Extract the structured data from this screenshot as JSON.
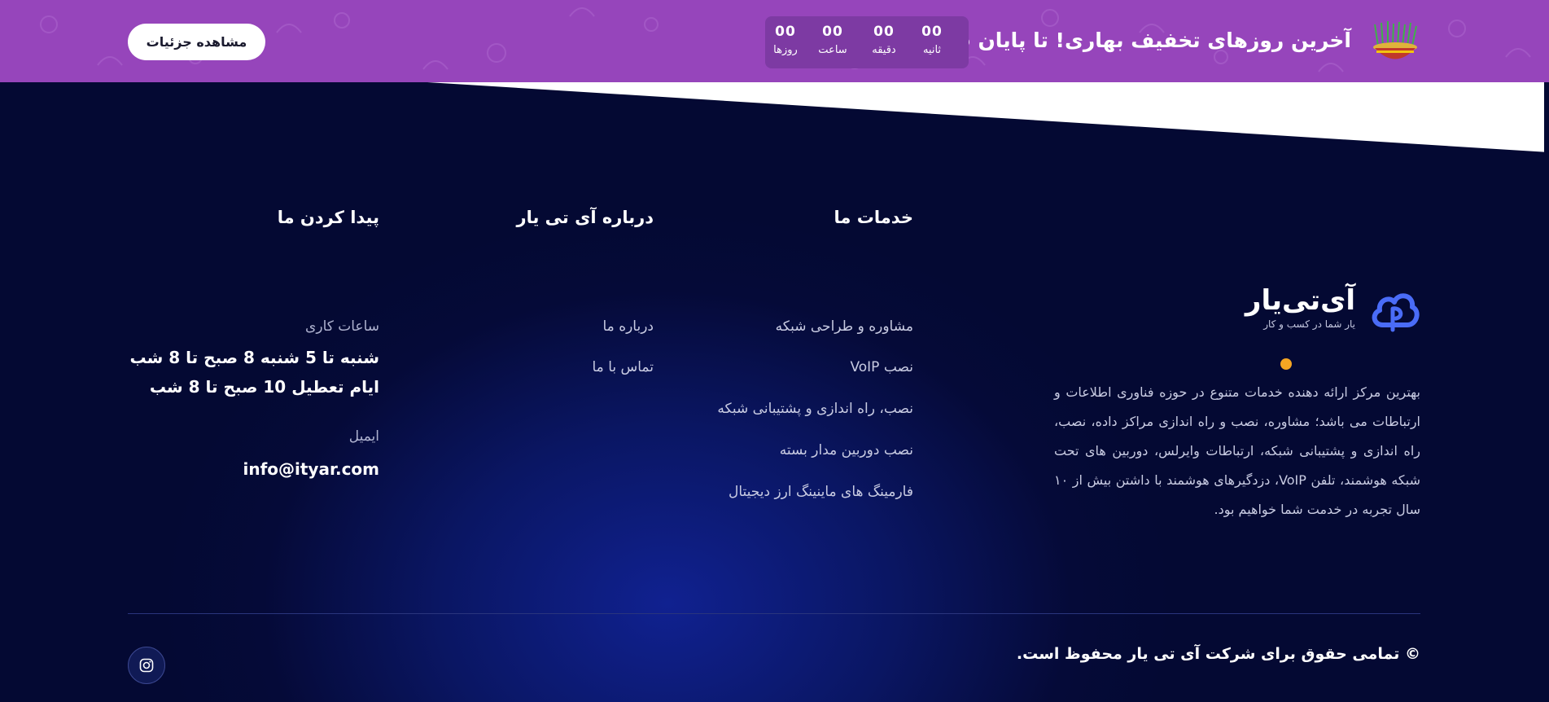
{
  "banner": {
    "title": "آخرین روزهای تخفیف بهاری! تا پایان فروردین",
    "countdown": [
      {
        "value": "00",
        "label": "ثانیه"
      },
      {
        "value": "00",
        "label": "دقیقه"
      },
      {
        "value": "00",
        "label": "ساعت"
      },
      {
        "value": "00",
        "label": "روزها"
      }
    ],
    "button_label": "مشاهده جزئیات",
    "background_color": "#9645bb"
  },
  "footer": {
    "brand": {
      "name": "آی‌تی‌یار",
      "tagline": "یار شما در کسب و کار",
      "description": "بهترین مرکز ارائه دهنده خدمات متنوع در حوزه فناوری اطلاعات و ارتباطات می باشد؛ مشاوره، نصب و راه اندازی مراکز داده، نصب، راه اندازی و پشتیبانی شبکه، ارتباطات وایرلس، دوربین های تحت شبکه هوشمند، تلفن VoIP، دزدگیرهای هوشمند با داشتن بیش از ۱۰ سال تجربه در خدمت شما خواهیم بود."
    },
    "services": {
      "title": "خدمات ما",
      "items": [
        "مشاوره و طراحی شبکه",
        "نصب VoIP",
        "نصب، راه اندازی و پشتیبانی شبکه",
        "نصب دوربین مدار بسته",
        "فارمینگ های ماینینگ ارز دیجیتال"
      ]
    },
    "about": {
      "title": "درباره آی تی یار",
      "items": [
        "درباره ما",
        "تماس با ما"
      ]
    },
    "contact": {
      "title": "پیدا کردن ما",
      "hours_label": "ساعات کاری",
      "hours_line1": "شنبه تا 5 شنبه 8 صبح تا 8 شب",
      "hours_line2": "ایام تعطیل 10 صبح تا 8 شب",
      "email_label": "ایمیل",
      "email": "info@ityar.com"
    },
    "copyright": "© تمامی حقوق برای شرکت آی تی یار محفوظ است.",
    "social_icon": "instagram-icon"
  },
  "colors": {
    "footer_bg": "#040933",
    "accent_blue": "#4a6cf7",
    "accent_orange": "#f5a623"
  }
}
